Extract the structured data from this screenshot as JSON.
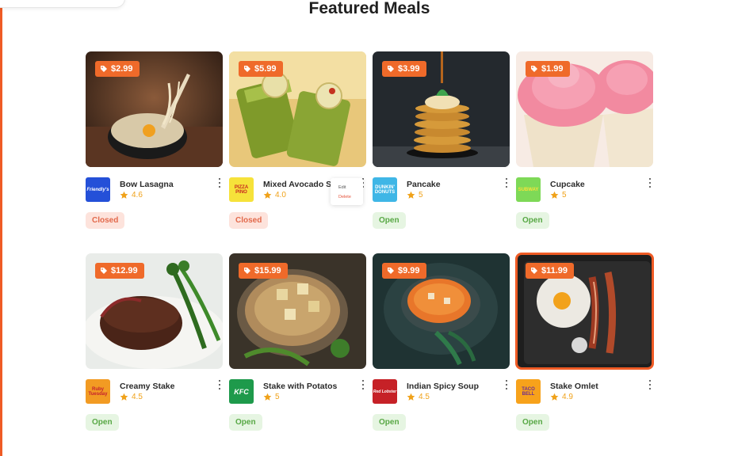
{
  "page": {
    "title": "Featured Meals"
  },
  "context_menu": {
    "edit": "Edit",
    "delete": "Delete"
  },
  "colors": {
    "accent": "#ef5b25",
    "price_tag": "#ef6a2a",
    "star": "#f0a21a",
    "open": "#58a845",
    "closed": "#e2694b"
  },
  "meals": [
    {
      "name": "Bow Lasagna",
      "price": "$2.99",
      "rating": "4.6",
      "status": "Closed",
      "logo": "Friendly's"
    },
    {
      "name": "Mixed Avocado Smoothie",
      "price": "$5.99",
      "rating": "4.0",
      "status": "Closed",
      "logo": "PIZZA PINO"
    },
    {
      "name": "Pancake",
      "price": "$3.99",
      "rating": "5",
      "status": "Open",
      "logo": "DUNKIN' DONUTS"
    },
    {
      "name": "Cupcake",
      "price": "$1.99",
      "rating": "5",
      "status": "Open",
      "logo": "SUBWAY"
    },
    {
      "name": "Creamy Stake",
      "price": "$12.99",
      "rating": "4.5",
      "status": "Open",
      "logo": "Ruby Tuesday"
    },
    {
      "name": "Stake with Potatos",
      "price": "$15.99",
      "rating": "5",
      "status": "Open",
      "logo": "KFC"
    },
    {
      "name": "Indian Spicy Soup",
      "price": "$9.99",
      "rating": "4.5",
      "status": "Open",
      "logo": "Red Lobster"
    },
    {
      "name": "Stake Omlet",
      "price": "$11.99",
      "rating": "4.9",
      "status": "Open",
      "logo": "TACO BELL"
    }
  ]
}
